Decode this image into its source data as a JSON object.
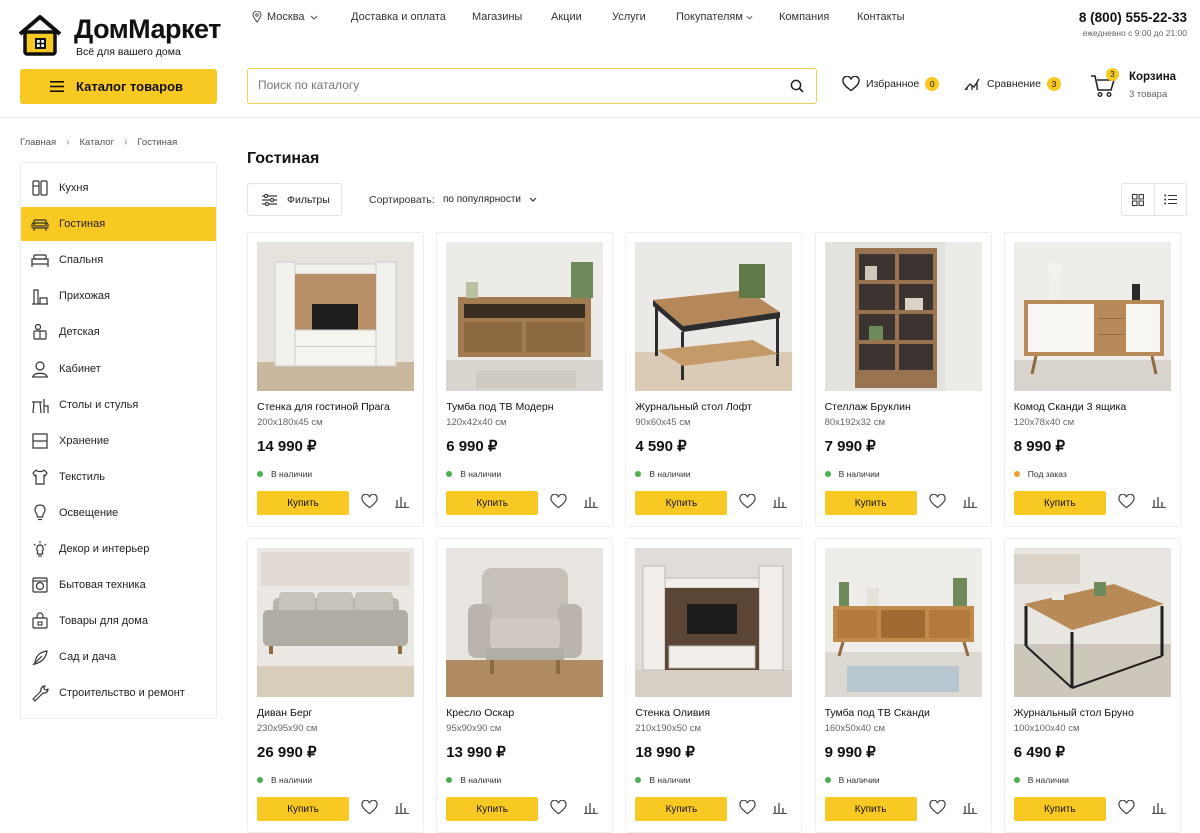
{
  "brand": {
    "name": "ДомМаркет",
    "tagline": "Всё для вашего дома"
  },
  "city": "Москва",
  "nav": [
    "Доставка и оплата",
    "Магазины",
    "Акции",
    "Услуги",
    "Покупателям",
    "Компания",
    "Контакты"
  ],
  "contacts": {
    "phone": "8 (800) 555-22-33",
    "hours": "ежедневно с 9:00 до 21:00"
  },
  "catalog_button": "Каталог товаров",
  "search": {
    "placeholder": "Поиск по каталогу"
  },
  "favorites": {
    "label": "Избранное",
    "count": "0"
  },
  "compare": {
    "label": "Сравнение",
    "count": "3"
  },
  "cart": {
    "label": "Корзина",
    "count": "3",
    "summary": "3 товара"
  },
  "breadcrumb": [
    "Главная",
    "Каталог",
    "Гостиная"
  ],
  "sidebar": [
    {
      "label": "Кухня",
      "icon": "kitchen-icon"
    },
    {
      "label": "Гостиная",
      "icon": "sofa-icon",
      "active": true
    },
    {
      "label": "Спальня",
      "icon": "bed-icon"
    },
    {
      "label": "Прихожая",
      "icon": "hallway-icon"
    },
    {
      "label": "Детская",
      "icon": "kids-icon"
    },
    {
      "label": "Кабинет",
      "icon": "office-icon"
    },
    {
      "label": "Столы и стулья",
      "icon": "table-chair-icon"
    },
    {
      "label": "Хранение",
      "icon": "storage-icon"
    },
    {
      "label": "Текстиль",
      "icon": "textile-icon"
    },
    {
      "label": "Освещение",
      "icon": "lamp-icon"
    },
    {
      "label": "Декор и интерьер",
      "icon": "decor-icon"
    },
    {
      "label": "Бытовая техника",
      "icon": "appliance-icon"
    },
    {
      "label": "Товары для дома",
      "icon": "home-goods-icon"
    },
    {
      "label": "Сад и дача",
      "icon": "garden-icon"
    },
    {
      "label": "Строительство и ремонт",
      "icon": "tools-icon"
    }
  ],
  "page_title": "Гостиная",
  "toolbar": {
    "filters": "Фильтры",
    "sort_label": "Сортировать:",
    "sort_value": "по популярности"
  },
  "buy_label": "Купить",
  "colors": {
    "accent": "#f9c923",
    "in_stock": "#4caf50",
    "on_order": "#f0a030"
  },
  "products": [
    {
      "name": "Стенка для гостиной Прага",
      "size": "200x180x45 см",
      "price": "14 990 ₽",
      "stock": "В наличии",
      "status": "in_stock",
      "image": "tv-wall-light"
    },
    {
      "name": "Тумба под ТВ Модерн",
      "size": "120x42x40 см",
      "price": "6 990 ₽",
      "stock": "В наличии",
      "status": "in_stock",
      "image": "tv-stand-oak"
    },
    {
      "name": "Журнальный стол Лофт",
      "size": "90x60x45 см",
      "price": "4 590 ₽",
      "stock": "В наличии",
      "status": "in_stock",
      "image": "coffee-table-loft"
    },
    {
      "name": "Стеллаж Бруклин",
      "size": "80x192x32 см",
      "price": "7 990 ₽",
      "stock": "В наличии",
      "status": "in_stock",
      "image": "shelf-brooklyn"
    },
    {
      "name": "Комод Сканди 3 ящика",
      "size": "120x78x40 см",
      "price": "8 990 ₽",
      "stock": "Под заказ",
      "status": "on_order",
      "image": "dresser-scandi"
    },
    {
      "name": "Диван Берг",
      "size": "230x95x90 см",
      "price": "26 990 ₽",
      "stock": "В наличии",
      "status": "in_stock",
      "image": "sofa-grey"
    },
    {
      "name": "Кресло Оскар",
      "size": "95x90x90 см",
      "price": "13 990 ₽",
      "stock": "В наличии",
      "status": "in_stock",
      "image": "armchair-grey"
    },
    {
      "name": "Стенка Оливия",
      "size": "210x190x50 см",
      "price": "18 990 ₽",
      "stock": "В наличии",
      "status": "in_stock",
      "image": "tv-wall-dark"
    },
    {
      "name": "Тумба под ТВ Сканди",
      "size": "160x50x40 см",
      "price": "9 990 ₽",
      "stock": "В наличии",
      "status": "in_stock",
      "image": "tv-stand-scandi"
    },
    {
      "name": "Журнальный стол Бруно",
      "size": "100x100x40 см",
      "price": "6 490 ₽",
      "stock": "В наличии",
      "status": "in_stock",
      "image": "coffee-table-bruno"
    }
  ]
}
